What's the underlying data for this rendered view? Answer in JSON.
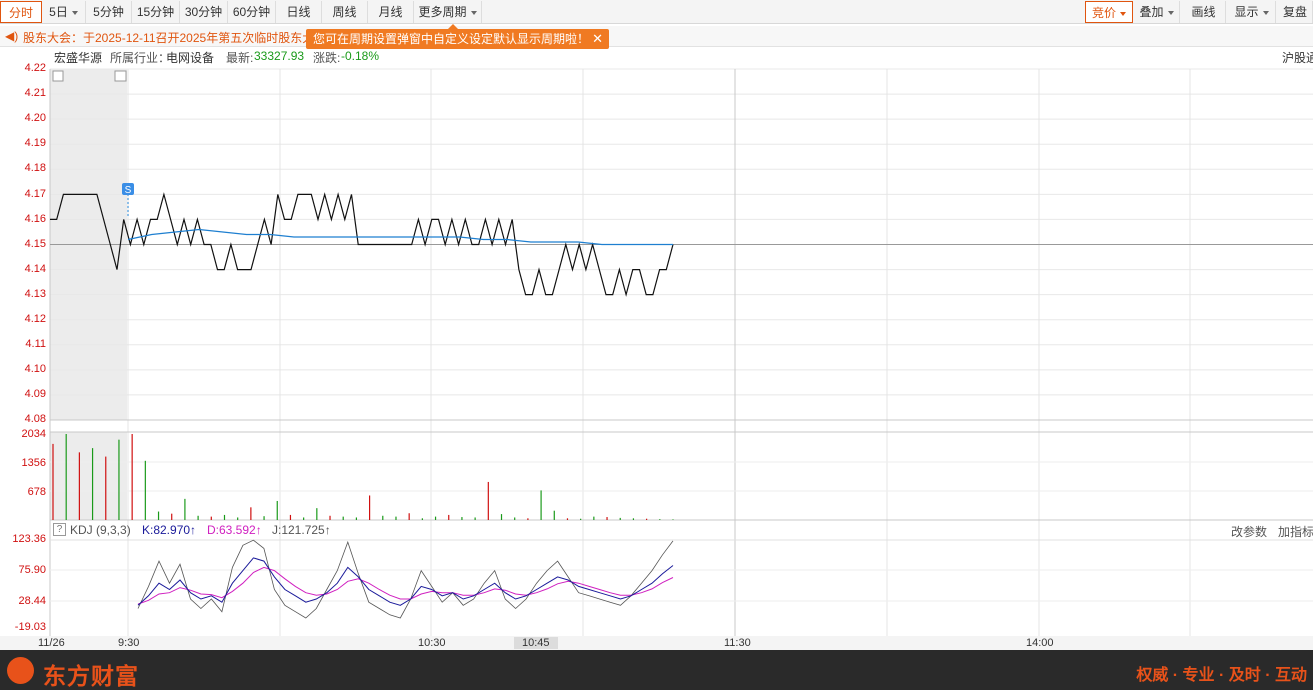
{
  "toolbar": {
    "periods": [
      {
        "label": "分时",
        "active": true
      },
      {
        "label": "5日",
        "caret": true
      },
      {
        "label": "5分钟"
      },
      {
        "label": "15分钟"
      },
      {
        "label": "30分钟"
      },
      {
        "label": "60分钟"
      },
      {
        "label": "日线"
      },
      {
        "label": "周线"
      },
      {
        "label": "月线"
      },
      {
        "label": "更多周期",
        "caret": true
      }
    ],
    "right": [
      {
        "label": "竞价",
        "caret": true,
        "active": true
      },
      {
        "label": "叠加",
        "caret": true
      },
      {
        "label": "画线"
      },
      {
        "label": "显示",
        "caret": true
      },
      {
        "label": "复盘"
      }
    ]
  },
  "notice": {
    "text": "股东大会：于2025-12-11召开2025年第五次临时股东大",
    "tip": "您可在周期设置弹窗中自定义设定默认显示周期啦！",
    "tip_close": "✕"
  },
  "info": {
    "name": "宏盛华源",
    "industry_label": "所属行业：",
    "industry": "电网设备",
    "latest_label": "最新:",
    "latest": "33327.93",
    "change_label": "涨跌:",
    "change": "-0.18%",
    "market": "沪股通"
  },
  "price_axis": [
    "4.22",
    "4.21",
    "4.20",
    "4.19",
    "4.18",
    "4.17",
    "4.16",
    "4.15",
    "4.14",
    "4.13",
    "4.12",
    "4.11",
    "4.10",
    "4.09",
    "4.08"
  ],
  "volume_axis": [
    "2034",
    "1356",
    "678"
  ],
  "kdj_axis": [
    "123.36",
    "75.90",
    "28.44",
    "-19.03"
  ],
  "kdj": {
    "help": "?",
    "title": "KDJ (9,3,3)",
    "k": "K:82.970↑",
    "d": "D:63.592↑",
    "j": "J:121.725↑",
    "params": "改参数",
    "add": "加指标"
  },
  "marker": "S",
  "time_axis": [
    {
      "label": "11/26"
    },
    {
      "label": "9:30"
    },
    {
      "label": "10:30"
    },
    {
      "label": "10:45",
      "highlight": true
    },
    {
      "label": "11:30"
    },
    {
      "label": "14:00"
    }
  ],
  "footer": {
    "brand": "东方财富",
    "slogan": "权威 · 专业 · 及时 · 互动"
  },
  "colors": {
    "accent": "#e0550f",
    "up": "#d01010",
    "down": "#1a9a1a",
    "avg_line": "#1e7fd0",
    "d_line": "#d020c0"
  },
  "chart_data": {
    "type": "line",
    "title": "",
    "ylim": [
      4.08,
      4.22
    ],
    "prev_close": 4.15,
    "series": [
      {
        "name": "",
        "values": [
          4.16,
          4.16,
          4.17,
          4.17,
          4.17,
          4.17,
          4.17,
          4.17,
          4.16,
          4.15,
          4.14,
          4.16,
          4.15,
          4.16,
          4.15,
          4.16,
          4.16,
          4.17,
          4.16,
          4.15,
          4.16,
          4.15,
          4.16,
          4.15,
          4.15,
          4.14,
          4.14,
          4.15,
          4.14,
          4.14,
          4.14,
          4.15,
          4.16,
          4.15,
          4.17,
          4.16,
          4.16,
          4.17,
          4.17,
          4.17,
          4.16,
          4.17,
          4.16,
          4.17,
          4.16,
          4.17,
          4.15,
          4.15,
          4.15,
          4.15,
          4.15,
          4.15,
          4.15,
          4.15,
          4.15,
          4.16,
          4.15,
          4.16,
          4.16,
          4.15,
          4.16,
          4.15,
          4.16,
          4.15,
          4.15,
          4.16,
          4.15,
          4.16,
          4.15,
          4.16,
          4.14,
          4.13,
          4.13,
          4.14,
          4.13,
          4.13,
          4.14,
          4.15,
          4.14,
          4.15,
          4.14,
          4.15,
          4.14,
          4.13,
          4.13,
          4.14,
          4.13,
          4.14,
          4.14,
          4.13,
          4.13,
          4.14,
          4.14,
          4.15
        ]
      },
      {
        "name": "",
        "values": [
          4.152,
          4.154,
          4.155,
          4.156,
          4.155,
          4.154,
          4.154,
          4.153,
          4.153,
          4.153,
          4.153,
          4.153,
          4.153,
          4.153,
          4.153,
          4.152,
          4.152,
          4.151,
          4.151,
          4.151,
          4.15,
          4.15,
          4.15,
          4.15
        ]
      }
    ],
    "volume": [
      1800,
      2034,
      1600,
      1700,
      1500,
      1900,
      2034,
      1400,
      200,
      150,
      500,
      100,
      80,
      120,
      60,
      300,
      90,
      450,
      120,
      60,
      280,
      100,
      80,
      60,
      580,
      100,
      80,
      160,
      40,
      80,
      120,
      70,
      60,
      900,
      140,
      60,
      40,
      700,
      220,
      40,
      30,
      80,
      70,
      50,
      40,
      30,
      20,
      15
    ],
    "kdj": {
      "k": [
        20,
        35,
        55,
        45,
        60,
        40,
        30,
        35,
        25,
        55,
        75,
        95,
        90,
        65,
        45,
        35,
        25,
        30,
        40,
        55,
        80,
        65,
        45,
        35,
        25,
        20,
        30,
        50,
        45,
        35,
        40,
        30,
        35,
        45,
        55,
        40,
        30,
        35,
        45,
        55,
        65,
        60,
        50,
        45,
        40,
        35,
        30,
        35,
        45,
        55,
        70,
        83
      ],
      "d": [
        22,
        28,
        38,
        40,
        48,
        44,
        38,
        37,
        32,
        42,
        55,
        72,
        80,
        75,
        62,
        50,
        40,
        36,
        38,
        45,
        58,
        62,
        55,
        45,
        36,
        30,
        30,
        38,
        42,
        40,
        40,
        36,
        36,
        40,
        46,
        44,
        38,
        36,
        40,
        46,
        54,
        58,
        55,
        50,
        45,
        40,
        36,
        36,
        40,
        46,
        56,
        64
      ],
      "j": [
        15,
        50,
        90,
        55,
        85,
        30,
        15,
        30,
        10,
        80,
        115,
        123,
        110,
        45,
        20,
        10,
        0,
        15,
        45,
        75,
        120,
        70,
        25,
        15,
        5,
        0,
        30,
        75,
        50,
        25,
        40,
        20,
        30,
        55,
        75,
        30,
        15,
        30,
        55,
        75,
        90,
        65,
        40,
        35,
        30,
        25,
        20,
        35,
        55,
        75,
        100,
        122
      ]
    }
  }
}
